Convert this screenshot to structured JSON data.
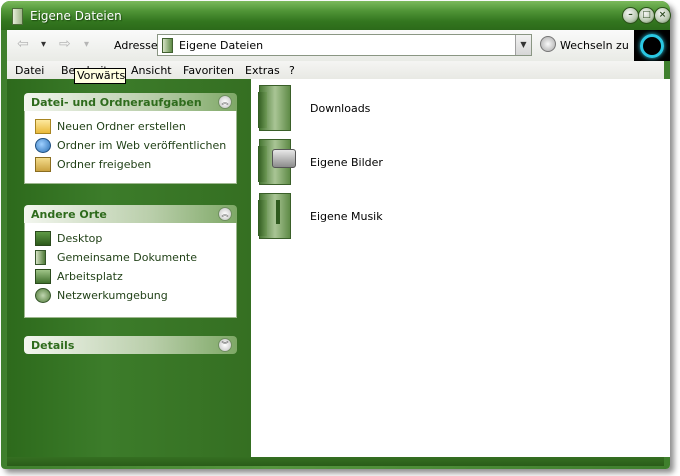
{
  "window": {
    "title": "Eigene Dateien"
  },
  "toolbar": {
    "back_arrow": "⇦",
    "back_dropdown": "▾",
    "forward_arrow": "⇨",
    "forward_dropdown": "▾",
    "address_label": "Adresse",
    "address_value": "Eigene Dateien",
    "go_label": "Wechseln zu"
  },
  "tooltip": {
    "text": "Vorwärts"
  },
  "menu": {
    "items": [
      "Datei",
      "Bearbeiten",
      "Ansicht",
      "Favoriten",
      "Extras",
      "?"
    ]
  },
  "taskpane": {
    "tasks": {
      "title": "Datei- und Ordneraufgaben",
      "items": [
        "Neuen Ordner erstellen",
        "Ordner im Web veröffentlichen",
        "Ordner freigeben"
      ]
    },
    "places": {
      "title": "Andere Orte",
      "items": [
        "Desktop",
        "Gemeinsame Dokumente",
        "Arbeitsplatz",
        "Netzwerkumgebung"
      ]
    },
    "details": {
      "title": "Details"
    }
  },
  "content": {
    "folders": [
      "Downloads",
      "Eigene Bilder",
      "Eigene Musik"
    ]
  },
  "colors": {
    "accent": "#3c7c2a",
    "header_text": "#2e6b1c"
  }
}
